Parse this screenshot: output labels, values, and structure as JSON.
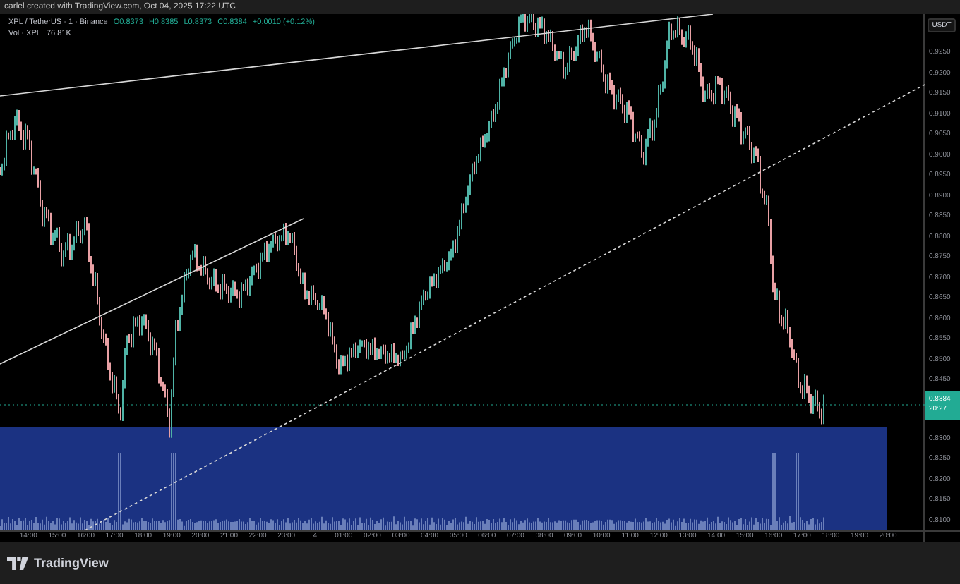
{
  "header": {
    "attribution": "carlel created with TradingView.com, Oct 04, 2025 17:22 UTC"
  },
  "legend": {
    "symbol": "XPL / TetherUS · 1 · Binance",
    "open": "O0.8373",
    "high": "H0.8385",
    "low": "L0.8373",
    "close": "C0.8384",
    "change": "+0.0010 (+0.12%)",
    "volume_label": "Vol · XPL",
    "volume": "76.81K"
  },
  "price_axis": {
    "currency": "USDT",
    "labels_upper": [
      "0.9250",
      "0.9200",
      "0.9150",
      "0.9100",
      "0.9050",
      "0.9000",
      "0.8950",
      "0.8900",
      "0.8850",
      "0.8800",
      "0.8750",
      "0.8700",
      "0.8650",
      "0.8600",
      "0.8550",
      "0.8500",
      "0.8450"
    ],
    "last_price": "0.8384",
    "countdown": "20:27",
    "labels_lower": [
      "0.8300",
      "0.8250",
      "0.8200",
      "0.8150",
      "0.8100"
    ]
  },
  "time_axis": {
    "labels": [
      "14:00",
      "15:00",
      "16:00",
      "17:00",
      "18:00",
      "19:00",
      "20:00",
      "21:00",
      "22:00",
      "23:00",
      "4",
      "01:00",
      "02:00",
      "03:00",
      "04:00",
      "05:00",
      "06:00",
      "07:00",
      "08:00",
      "09:00",
      "10:00",
      "11:00",
      "12:00",
      "13:00",
      "14:00",
      "15:00",
      "16:00",
      "17:00",
      "18:00",
      "19:00",
      "20:00"
    ]
  },
  "footer": {
    "brand": "TradingView"
  }
}
